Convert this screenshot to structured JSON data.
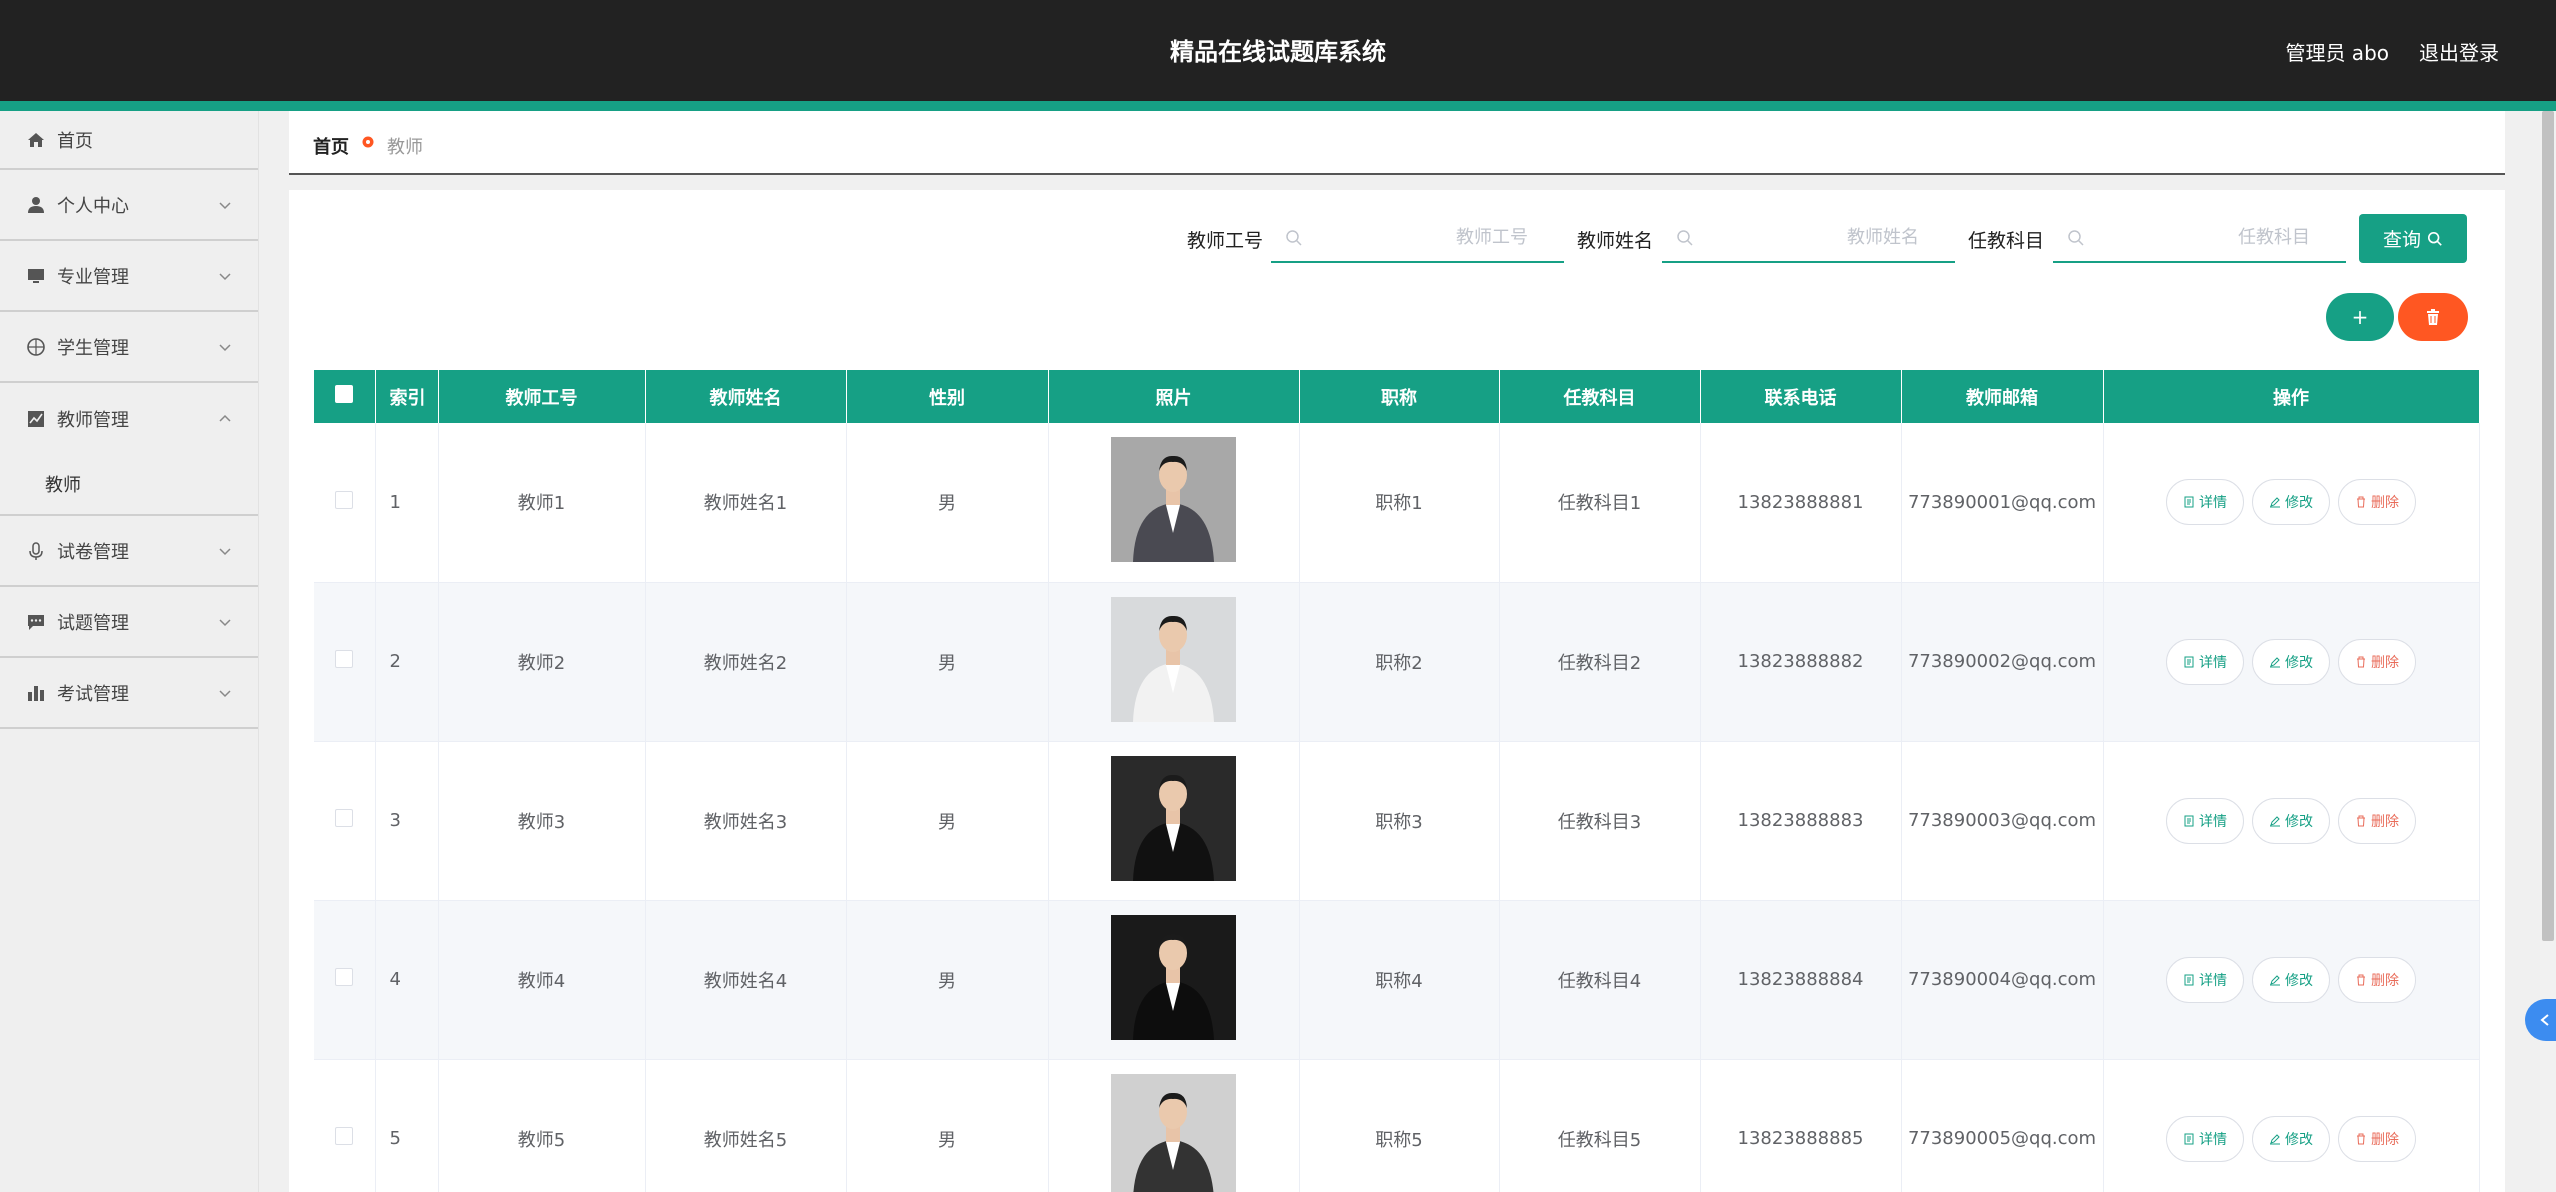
{
  "header": {
    "title": "精品在线试题库系统",
    "user": "管理员 abo",
    "logout": "退出登录"
  },
  "sidebar": {
    "items": [
      {
        "label": "首页",
        "icon": "home-icon"
      },
      {
        "label": "个人中心",
        "icon": "user-icon"
      },
      {
        "label": "专业管理",
        "icon": "monitor-icon"
      },
      {
        "label": "学生管理",
        "icon": "compass-icon"
      },
      {
        "label": "教师管理",
        "icon": "chart-icon"
      },
      {
        "label": "试卷管理",
        "icon": "microphone-icon"
      },
      {
        "label": "试题管理",
        "icon": "message-icon"
      },
      {
        "label": "考试管理",
        "icon": "bar-chart-icon"
      }
    ],
    "sub_item": "教师"
  },
  "breadcrumb": {
    "home": "首页",
    "current": "教师"
  },
  "search": {
    "fields": [
      {
        "label": "教师工号",
        "placeholder": "教师工号"
      },
      {
        "label": "教师姓名",
        "placeholder": "教师姓名"
      },
      {
        "label": "任教科目",
        "placeholder": "任教科目"
      }
    ],
    "query_button": "查询"
  },
  "actions": {
    "add": "+",
    "accent_color": "#16a085",
    "danger_color": "#ff5722"
  },
  "table": {
    "headers": [
      "索引",
      "教师工号",
      "教师姓名",
      "性别",
      "照片",
      "职称",
      "任教科目",
      "联系电话",
      "教师邮箱",
      "操作"
    ],
    "op_labels": {
      "detail": "详情",
      "edit": "修改",
      "delete": "删除"
    },
    "rows": [
      {
        "idx": "1",
        "no": "教师1",
        "name": "教师姓名1",
        "gender": "男",
        "title": "职称1",
        "subject": "任教科目1",
        "phone": "13823888881",
        "email": "773890001@qq.com"
      },
      {
        "idx": "2",
        "no": "教师2",
        "name": "教师姓名2",
        "gender": "男",
        "title": "职称2",
        "subject": "任教科目2",
        "phone": "13823888882",
        "email": "773890002@qq.com"
      },
      {
        "idx": "3",
        "no": "教师3",
        "name": "教师姓名3",
        "gender": "男",
        "title": "职称3",
        "subject": "任教科目3",
        "phone": "13823888883",
        "email": "773890003@qq.com"
      },
      {
        "idx": "4",
        "no": "教师4",
        "name": "教师姓名4",
        "gender": "男",
        "title": "职称4",
        "subject": "任教科目4",
        "phone": "13823888884",
        "email": "773890004@qq.com"
      },
      {
        "idx": "5",
        "no": "教师5",
        "name": "教师姓名5",
        "gender": "男",
        "title": "职称5",
        "subject": "任教科目5",
        "phone": "13823888885",
        "email": "773890005@qq.com"
      }
    ]
  }
}
